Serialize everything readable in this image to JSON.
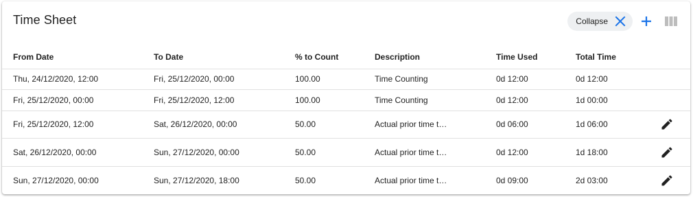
{
  "title": "Time Sheet",
  "toolbar": {
    "collapse_label": "Collapse",
    "collapse_icon": "close-icon",
    "add_icon": "plus-icon",
    "columns_icon": "view-columns-icon",
    "accent": "#1a73e8"
  },
  "table": {
    "headers": {
      "from": "From Date",
      "to": "To Date",
      "pct": "% to Count",
      "desc": "Description",
      "used": "Time Used",
      "total": "Total Time"
    },
    "rows": [
      {
        "from": "Thu, 24/12/2020, 12:00",
        "to": "Fri, 25/12/2020, 00:00",
        "pct": "100.00",
        "desc": "Time Counting",
        "used": "0d 12:00",
        "total": "0d 12:00",
        "editable": false
      },
      {
        "from": "Fri, 25/12/2020, 00:00",
        "to": "Fri, 25/12/2020, 12:00",
        "pct": "100.00",
        "desc": "Time Counting",
        "used": "0d 12:00",
        "total": "1d 00:00",
        "editable": false
      },
      {
        "from": "Fri, 25/12/2020, 12:00",
        "to": "Sat, 26/12/2020, 00:00",
        "pct": "50.00",
        "desc": "Actual prior time t…",
        "used": "0d 06:00",
        "total": "1d 06:00",
        "editable": true
      },
      {
        "from": "Sat, 26/12/2020, 00:00",
        "to": "Sun, 27/12/2020, 00:00",
        "pct": "50.00",
        "desc": "Actual prior time t…",
        "used": "0d 12:00",
        "total": "1d 18:00",
        "editable": true
      },
      {
        "from": "Sun, 27/12/2020, 00:00",
        "to": "Sun, 27/12/2020, 18:00",
        "pct": "50.00",
        "desc": "Actual prior time t…",
        "used": "0d 09:00",
        "total": "2d 03:00",
        "editable": true
      }
    ],
    "edit_icon": "pencil-icon"
  }
}
